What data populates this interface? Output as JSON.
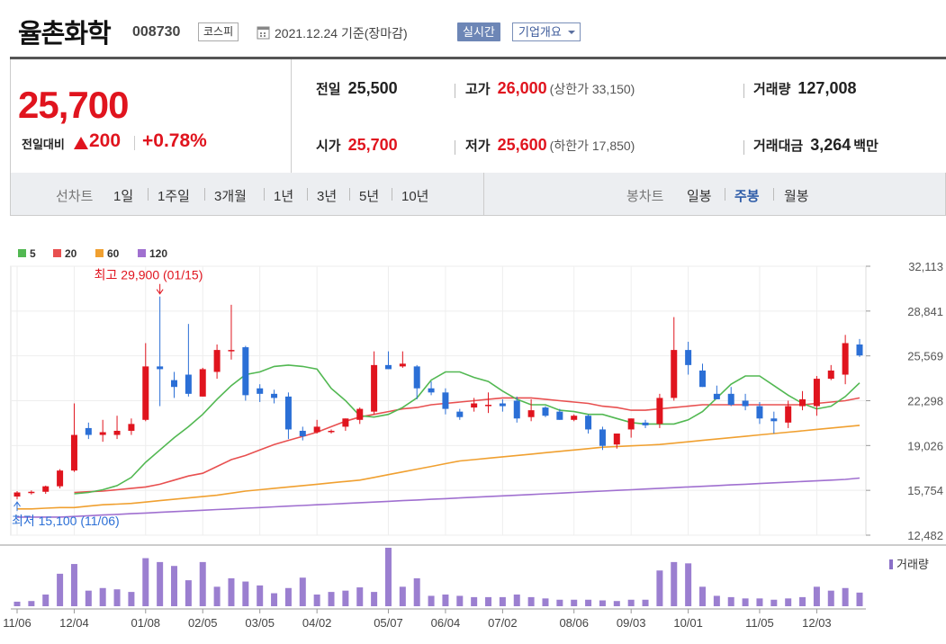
{
  "header": {
    "stock_name": "율촌화학",
    "stock_code": "008730",
    "market": "코스피",
    "base_date": "2021.12.24 기준(장마감)",
    "realtime_label": "실시간",
    "company_label": "기업개요"
  },
  "quote": {
    "current_price": "25,700",
    "change_label": "전일대비",
    "change_value": "200",
    "change_rate": "+0.78%",
    "prev_close_label": "전일",
    "prev_close": "25,500",
    "high_label": "고가",
    "high": "26,000",
    "upper_limit": "(상한가 33,150)",
    "volume_label": "거래량",
    "volume": "127,008",
    "open_label": "시가",
    "open": "25,700",
    "low_label": "저가",
    "low": "25,600",
    "lower_limit": "(하한가 17,850)",
    "amount_label": "거래대금",
    "amount": "3,264",
    "amount_unit": "백만"
  },
  "periods": {
    "line_chart_label": "선차트",
    "line_items": [
      "1일",
      "1주일",
      "3개월",
      "1년",
      "3년",
      "5년",
      "10년"
    ],
    "candle_chart_label": "봉차트",
    "candle_items": [
      "일봉",
      "주봉",
      "월봉"
    ],
    "active_candle": "주봉"
  },
  "colors": {
    "up": "#e0141e",
    "down": "#2b6fd6",
    "ma5": "#52b852",
    "ma20": "#e85050",
    "ma60": "#f0a030",
    "ma120": "#a070d0"
  },
  "chart_data": {
    "type": "candlestick",
    "legend": [
      {
        "name": "5",
        "color": "#52b852"
      },
      {
        "name": "20",
        "color": "#e85050"
      },
      {
        "name": "60",
        "color": "#f0a030"
      },
      {
        "name": "120",
        "color": "#a070d0"
      }
    ],
    "y_ticks": [
      "32,113",
      "28,841",
      "25,569",
      "22,298",
      "19,026",
      "15,754",
      "12,482"
    ],
    "ylim": [
      12482,
      32113
    ],
    "x_ticks": [
      {
        "i": 0,
        "label": "11/06"
      },
      {
        "i": 4,
        "label": "12/04"
      },
      {
        "i": 9,
        "label": "01/08"
      },
      {
        "i": 13,
        "label": "02/05"
      },
      {
        "i": 17,
        "label": "03/05"
      },
      {
        "i": 21,
        "label": "04/02"
      },
      {
        "i": 26,
        "label": "05/07"
      },
      {
        "i": 30,
        "label": "06/04"
      },
      {
        "i": 34,
        "label": "07/02"
      },
      {
        "i": 39,
        "label": "08/06"
      },
      {
        "i": 43,
        "label": "09/03"
      },
      {
        "i": 47,
        "label": "10/01"
      },
      {
        "i": 52,
        "label": "11/05"
      },
      {
        "i": 56,
        "label": "12/03"
      }
    ],
    "high_annotation": "최고 29,900 (01/15)",
    "low_annotation": "최저 15,100 (11/06)",
    "high_index": 10,
    "low_index": 0,
    "volume_label": "거래량",
    "candles": [
      {
        "o": 15300,
        "h": 15700,
        "l": 15100,
        "c": 15600
      },
      {
        "o": 15600,
        "h": 15750,
        "l": 15450,
        "c": 15650
      },
      {
        "o": 15650,
        "h": 16100,
        "l": 15500,
        "c": 16050
      },
      {
        "o": 16050,
        "h": 17300,
        "l": 15900,
        "c": 17200
      },
      {
        "o": 17200,
        "h": 22100,
        "l": 17100,
        "c": 19800
      },
      {
        "o": 20300,
        "h": 20700,
        "l": 19500,
        "c": 19800
      },
      {
        "o": 19800,
        "h": 20900,
        "l": 19300,
        "c": 20000
      },
      {
        "o": 19800,
        "h": 21200,
        "l": 19500,
        "c": 20100
      },
      {
        "o": 20100,
        "h": 21000,
        "l": 19800,
        "c": 20600
      },
      {
        "o": 20900,
        "h": 26500,
        "l": 20800,
        "c": 24800
      },
      {
        "o": 24800,
        "h": 29900,
        "l": 21900,
        "c": 24600
      },
      {
        "o": 23800,
        "h": 24400,
        "l": 22500,
        "c": 23300
      },
      {
        "o": 24200,
        "h": 27900,
        "l": 22600,
        "c": 22800
      },
      {
        "o": 22600,
        "h": 24700,
        "l": 22600,
        "c": 24600
      },
      {
        "o": 24400,
        "h": 26400,
        "l": 23900,
        "c": 26000
      },
      {
        "o": 26000,
        "h": 29300,
        "l": 25300,
        "c": 26000
      },
      {
        "o": 26200,
        "h": 26300,
        "l": 22300,
        "c": 22700
      },
      {
        "o": 23200,
        "h": 23500,
        "l": 22200,
        "c": 22800
      },
      {
        "o": 22800,
        "h": 23100,
        "l": 22100,
        "c": 22500
      },
      {
        "o": 22600,
        "h": 22900,
        "l": 19500,
        "c": 20200
      },
      {
        "o": 20100,
        "h": 20400,
        "l": 19400,
        "c": 19700
      },
      {
        "o": 20000,
        "h": 20900,
        "l": 19900,
        "c": 20400
      },
      {
        "o": 20000,
        "h": 20200,
        "l": 19900,
        "c": 20100
      },
      {
        "o": 20400,
        "h": 21000,
        "l": 20100,
        "c": 21000
      },
      {
        "o": 20900,
        "h": 21800,
        "l": 20600,
        "c": 21700
      },
      {
        "o": 21500,
        "h": 25900,
        "l": 21300,
        "c": 24900
      },
      {
        "o": 24900,
        "h": 25900,
        "l": 24600,
        "c": 24600
      },
      {
        "o": 24800,
        "h": 25900,
        "l": 24700,
        "c": 25000
      },
      {
        "o": 24800,
        "h": 24900,
        "l": 22400,
        "c": 23200
      },
      {
        "o": 23200,
        "h": 23700,
        "l": 22700,
        "c": 22900
      },
      {
        "o": 22900,
        "h": 23200,
        "l": 21300,
        "c": 21700
      },
      {
        "o": 21500,
        "h": 21700,
        "l": 20900,
        "c": 21100
      },
      {
        "o": 21800,
        "h": 22500,
        "l": 21500,
        "c": 22100
      },
      {
        "o": 22000,
        "h": 22900,
        "l": 21400,
        "c": 22000
      },
      {
        "o": 22100,
        "h": 22400,
        "l": 21500,
        "c": 21900
      },
      {
        "o": 22300,
        "h": 22600,
        "l": 20700,
        "c": 21000
      },
      {
        "o": 21100,
        "h": 22400,
        "l": 20800,
        "c": 21600
      },
      {
        "o": 21800,
        "h": 21900,
        "l": 21100,
        "c": 21200
      },
      {
        "o": 21500,
        "h": 21700,
        "l": 20900,
        "c": 20900
      },
      {
        "o": 20900,
        "h": 21300,
        "l": 20800,
        "c": 21200
      },
      {
        "o": 21200,
        "h": 21300,
        "l": 19900,
        "c": 20200
      },
      {
        "o": 20200,
        "h": 20400,
        "l": 18700,
        "c": 19000
      },
      {
        "o": 19100,
        "h": 19900,
        "l": 18800,
        "c": 19900
      },
      {
        "o": 20200,
        "h": 21000,
        "l": 19600,
        "c": 21000
      },
      {
        "o": 20700,
        "h": 20900,
        "l": 20300,
        "c": 20500
      },
      {
        "o": 20600,
        "h": 22800,
        "l": 20300,
        "c": 22500
      },
      {
        "o": 22500,
        "h": 28400,
        "l": 22300,
        "c": 26000
      },
      {
        "o": 26000,
        "h": 26600,
        "l": 24200,
        "c": 24900
      },
      {
        "o": 24500,
        "h": 25000,
        "l": 23300,
        "c": 23300
      },
      {
        "o": 22800,
        "h": 23400,
        "l": 22500,
        "c": 22400
      },
      {
        "o": 22800,
        "h": 23300,
        "l": 21900,
        "c": 22000
      },
      {
        "o": 22300,
        "h": 22800,
        "l": 21600,
        "c": 21900
      },
      {
        "o": 21900,
        "h": 22200,
        "l": 20600,
        "c": 21000
      },
      {
        "o": 21000,
        "h": 21500,
        "l": 19900,
        "c": 20800
      },
      {
        "o": 20700,
        "h": 22300,
        "l": 20300,
        "c": 21900
      },
      {
        "o": 21900,
        "h": 23000,
        "l": 21600,
        "c": 22400
      },
      {
        "o": 21900,
        "h": 24100,
        "l": 21200,
        "c": 23900
      },
      {
        "o": 23900,
        "h": 24900,
        "l": 23800,
        "c": 24500
      },
      {
        "o": 24200,
        "h": 27100,
        "l": 23500,
        "c": 26500
      },
      {
        "o": 26400,
        "h": 26800,
        "l": 25500,
        "c": 25600
      }
    ],
    "ma5": [
      null,
      null,
      null,
      null,
      15500,
      15600,
      15800,
      16100,
      16700,
      17800,
      18700,
      19600,
      20400,
      21300,
      22400,
      23400,
      24200,
      24400,
      24800,
      24900,
      24800,
      24600,
      23200,
      22300,
      21200,
      21100,
      21300,
      21800,
      22500,
      23800,
      24400,
      24400,
      24000,
      23700,
      23000,
      22400,
      22000,
      22000,
      21600,
      21500,
      21300,
      21300,
      21000,
      20700,
      20600,
      20600,
      20600,
      20900,
      21500,
      22500,
      23500,
      24100,
      24100,
      23400,
      22700,
      22100,
      21700,
      21900,
      22600,
      23600
    ],
    "ma20": [
      null,
      null,
      null,
      null,
      15600,
      15650,
      15700,
      15800,
      15900,
      16000,
      16200,
      16500,
      16800,
      17000,
      17500,
      18000,
      18300,
      18700,
      19100,
      19400,
      19700,
      20000,
      20400,
      20800,
      21100,
      21300,
      21500,
      21700,
      21800,
      22000,
      22100,
      22200,
      22300,
      22400,
      22500,
      22500,
      22500,
      22400,
      22300,
      22200,
      22100,
      21900,
      21800,
      21600,
      21600,
      21700,
      21800,
      21900,
      22000,
      22000,
      22000,
      22000,
      22000,
      22000,
      22000,
      22000,
      22100,
      22200,
      22300,
      22500
    ],
    "ma60": [
      14400,
      14400,
      14450,
      14500,
      14500,
      14600,
      14700,
      14750,
      14800,
      14900,
      15000,
      15100,
      15200,
      15300,
      15400,
      15550,
      15700,
      15800,
      15900,
      16000,
      16100,
      16200,
      16300,
      16400,
      16500,
      16700,
      16900,
      17100,
      17300,
      17500,
      17700,
      17900,
      18000,
      18100,
      18200,
      18300,
      18400,
      18500,
      18600,
      18700,
      18800,
      18900,
      18950,
      19000,
      19050,
      19100,
      19200,
      19300,
      19400,
      19500,
      19600,
      19700,
      19800,
      19900,
      20000,
      20100,
      20200,
      20300,
      20400,
      20500
    ],
    "ma120": [
      13800,
      13800,
      13800,
      13800,
      13850,
      13900,
      13950,
      14000,
      14050,
      14100,
      14150,
      14200,
      14250,
      14300,
      14350,
      14400,
      14450,
      14500,
      14550,
      14600,
      14650,
      14700,
      14750,
      14800,
      14850,
      14900,
      14950,
      15000,
      15050,
      15100,
      15150,
      15200,
      15250,
      15300,
      15350,
      15400,
      15450,
      15500,
      15550,
      15600,
      15650,
      15700,
      15750,
      15800,
      15850,
      15900,
      15950,
      16000,
      16050,
      16100,
      16150,
      16200,
      16250,
      16300,
      16350,
      16400,
      16450,
      16500,
      16550,
      16650
    ],
    "volume": [
      7,
      8,
      18,
      50,
      65,
      24,
      28,
      26,
      22,
      74,
      68,
      62,
      40,
      68,
      30,
      43,
      38,
      32,
      20,
      28,
      44,
      18,
      22,
      24,
      29,
      22,
      90,
      30,
      43,
      16,
      18,
      16,
      14,
      14,
      14,
      18,
      14,
      12,
      10,
      10,
      10,
      9,
      8,
      10,
      10,
      55,
      68,
      66,
      30,
      16,
      14,
      12,
      12,
      10,
      12,
      14,
      30,
      24,
      28,
      21
    ]
  }
}
